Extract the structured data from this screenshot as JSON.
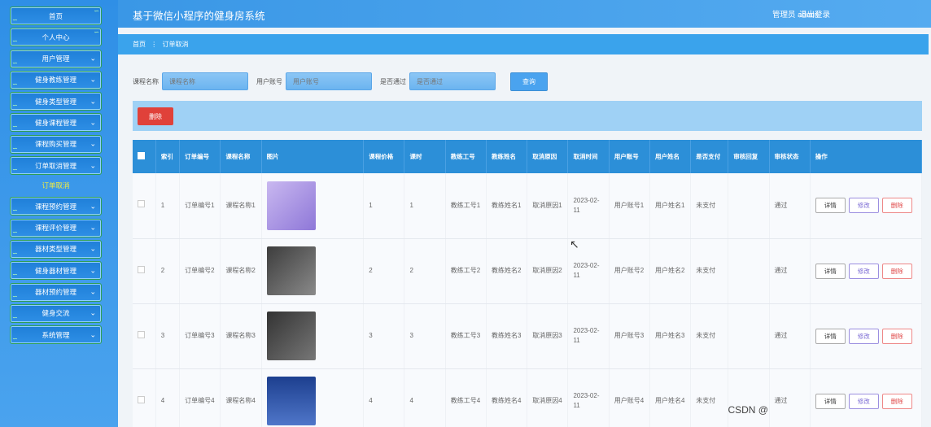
{
  "app_title": "基于微信小程序的健身房系统",
  "header": {
    "user_label": "管理员 admin",
    "logout_label": "退出登录"
  },
  "sidebar": {
    "items": [
      {
        "label": "首页"
      },
      {
        "label": "个人中心"
      },
      {
        "label": "用户管理"
      },
      {
        "label": "健身教练管理"
      },
      {
        "label": "健身类型管理"
      },
      {
        "label": "健身课程管理"
      },
      {
        "label": "课程购买管理"
      },
      {
        "label": "订单取消管理"
      },
      {
        "label": "课程预约管理"
      },
      {
        "label": "课程评价管理"
      },
      {
        "label": "器材类型管理"
      },
      {
        "label": "健身器材管理"
      },
      {
        "label": "器材预约管理"
      },
      {
        "label": "健身交流"
      },
      {
        "label": "系统管理"
      }
    ],
    "active_submenu": "订单取消"
  },
  "breadcrumb": {
    "home": "首页",
    "separator": "⋮",
    "current": "订单取消"
  },
  "search": {
    "course_label": "课程名称",
    "course_placeholder": "课程名称",
    "account_label": "用户账号",
    "account_placeholder": "用户账号",
    "passed_label": "是否通过",
    "passed_placeholder": "是否通过",
    "button": "查询"
  },
  "actions": {
    "delete": "删除"
  },
  "table": {
    "headers": [
      "索引",
      "订单编号",
      "课程名称",
      "图片",
      "课程价格",
      "课时",
      "教练工号",
      "教练姓名",
      "取消原因",
      "取消时间",
      "用户账号",
      "用户姓名",
      "是否支付",
      "审核回复",
      "审核状态",
      "操作"
    ],
    "rows": [
      {
        "idx": "1",
        "order": "订单编号1",
        "course": "课程名称1",
        "price": "1",
        "hours": "1",
        "coach_no": "教练工号1",
        "coach_name": "教练姓名1",
        "reason": "取消原因1",
        "time": "2023-02-11",
        "account": "用户账号1",
        "uname": "用户姓名1",
        "paid": "未支付",
        "reply": "",
        "status": "通过"
      },
      {
        "idx": "2",
        "order": "订单编号2",
        "course": "课程名称2",
        "price": "2",
        "hours": "2",
        "coach_no": "教练工号2",
        "coach_name": "教练姓名2",
        "reason": "取消原因2",
        "time": "2023-02-11",
        "account": "用户账号2",
        "uname": "用户姓名2",
        "paid": "未支付",
        "reply": "",
        "status": "通过"
      },
      {
        "idx": "3",
        "order": "订单编号3",
        "course": "课程名称3",
        "price": "3",
        "hours": "3",
        "coach_no": "教练工号3",
        "coach_name": "教练姓名3",
        "reason": "取消原因3",
        "time": "2023-02-11",
        "account": "用户账号3",
        "uname": "用户姓名3",
        "paid": "未支付",
        "reply": "",
        "status": "通过"
      },
      {
        "idx": "4",
        "order": "订单编号4",
        "course": "课程名称4",
        "price": "4",
        "hours": "4",
        "coach_no": "教练工号4",
        "coach_name": "教练姓名4",
        "reason": "取消原因4",
        "time": "2023-02-11",
        "account": "用户账号4",
        "uname": "用户姓名4",
        "paid": "未支付",
        "reply": "",
        "status": "通过"
      }
    ],
    "ops": {
      "detail": "详情",
      "edit": "修改",
      "delete": "删除"
    }
  },
  "watermark": "CSDN @"
}
